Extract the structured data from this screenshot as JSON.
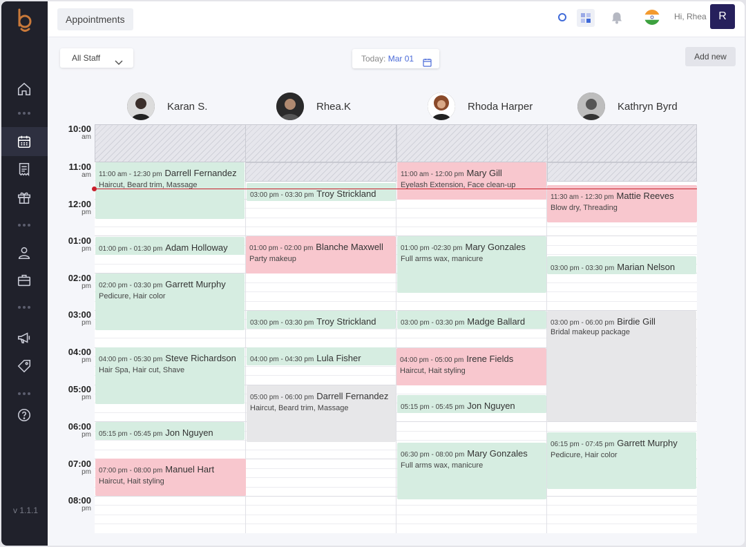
{
  "app": {
    "version": "v 1.1.1"
  },
  "header": {
    "title": "Appointments",
    "greeting": "Hi, Rhea",
    "avatar_initial": "R",
    "icons": [
      "search-icon",
      "apps-icon",
      "bell-icon",
      "india-flag-icon"
    ]
  },
  "sidebar": {
    "items": [
      "home-icon",
      "calendar-icon",
      "receipt-icon",
      "gift-icon",
      "user-icon",
      "briefcase-icon",
      "megaphone-icon",
      "tag-icon",
      "help-icon"
    ],
    "active": "calendar-icon"
  },
  "toolbar": {
    "staff_filter": "All Staff",
    "today_label": "Today:",
    "today_date": "Mar 01",
    "add_label": "Add new"
  },
  "staff": [
    {
      "name": "Karan S."
    },
    {
      "name": "Rhea.K"
    },
    {
      "name": "Rhoda Harper"
    },
    {
      "name": "Kathryn Byrd"
    }
  ],
  "times": [
    {
      "h": "10:00",
      "p": "am"
    },
    {
      "h": "11:00",
      "p": "am"
    },
    {
      "h": "12:00",
      "p": "pm"
    },
    {
      "h": "01:00",
      "p": "pm"
    },
    {
      "h": "02:00",
      "p": "pm"
    },
    {
      "h": "03:00",
      "p": "pm"
    },
    {
      "h": "04:00",
      "p": "pm"
    },
    {
      "h": "05:00",
      "p": "pm"
    },
    {
      "h": "06:00",
      "p": "pm"
    },
    {
      "h": "07:00",
      "p": "pm"
    },
    {
      "h": "08:00",
      "p": "pm"
    }
  ],
  "appointments": {
    "karan": [
      {
        "time": "11:00 am - 12:30 pm",
        "name": "Darrell Fernandez",
        "service": "Haircut, Beard trim, Massage",
        "status": "green"
      },
      {
        "time": "01:00 pm - 01:30 pm",
        "name": "Adam Holloway",
        "service": "",
        "status": "green"
      },
      {
        "time": "02:00 pm - 03:30 pm",
        "name": "Garrett Murphy",
        "service": "Pedicure, Hair color",
        "status": "green"
      },
      {
        "time": "04:00 pm - 05:30 pm",
        "name": "Steve Richardson",
        "service": "Hair Spa, Hair cut, Shave",
        "status": "green"
      },
      {
        "time": "05:15 pm - 05:45 pm",
        "name": "Jon Nguyen",
        "service": "",
        "status": "green"
      },
      {
        "time": "07:00 pm - 08:00 pm",
        "name": "Manuel Hart",
        "service": "Haircut, Hait styling",
        "status": "pink"
      }
    ],
    "rhea": [
      {
        "time": "03:00 pm - 03:30 pm",
        "name": "Troy Strickland",
        "service": "",
        "status": "green"
      },
      {
        "time": "01:00 pm - 02:00 pm",
        "name": "Blanche Maxwell",
        "service": "Party makeup",
        "status": "pink"
      },
      {
        "time": "03:00 pm - 03:30 pm",
        "name": "Troy Strickland",
        "service": "",
        "status": "green"
      },
      {
        "time": "04:00 pm - 04:30 pm",
        "name": "Lula Fisher",
        "service": "",
        "status": "green"
      },
      {
        "time": "05:00 pm - 06:00 pm",
        "name": "Darrell Fernandez",
        "service": "Haircut, Beard trim, Massage",
        "status": "grey"
      }
    ],
    "rhoda": [
      {
        "time": "11:00 am - 12:00 pm",
        "name": "Mary Gill",
        "service": "Eyelash Extension, Face clean-up",
        "status": "pink"
      },
      {
        "time": "01:00 pm -02:30 pm",
        "name": "Mary Gonzales",
        "service": "Full arms wax, manicure",
        "status": "green"
      },
      {
        "time": "03:00 pm - 03:30 pm",
        "name": "Madge Ballard",
        "service": "",
        "status": "green"
      },
      {
        "time": "04:00 pm - 05:00 pm",
        "name": "Irene Fields",
        "service": "Haircut, Hait styling",
        "status": "pink"
      },
      {
        "time": "05:15 pm - 05:45 pm",
        "name": "Jon Nguyen",
        "service": "",
        "status": "green"
      },
      {
        "time": "06:30 pm - 08:00 pm",
        "name": "Mary Gonzales",
        "service": "Full arms wax, manicure",
        "status": "green"
      }
    ],
    "kathryn": [
      {
        "time": "11:30 am - 12:30 pm",
        "name": "Mattie Reeves",
        "service": "Blow dry, Threading",
        "status": "pink"
      },
      {
        "time": "03:00 pm - 03:30 pm",
        "name": "Marian Nelson",
        "service": "",
        "status": "green"
      },
      {
        "time": "03:00 pm - 06:00 pm",
        "name": "Birdie Gill",
        "service": "Bridal makeup package",
        "status": "grey"
      },
      {
        "time": "06:15 pm - 07:45 pm",
        "name": "Garrett Murphy",
        "service": "Pedicure, Hair color",
        "status": "green"
      }
    ]
  },
  "colors": {
    "sidebar": "#20212b",
    "green": "#d6ede1",
    "pink": "#f8c7ce",
    "grey": "#e7e7e9",
    "now_line": "#c8202b",
    "accent": "#4a6ad8"
  }
}
